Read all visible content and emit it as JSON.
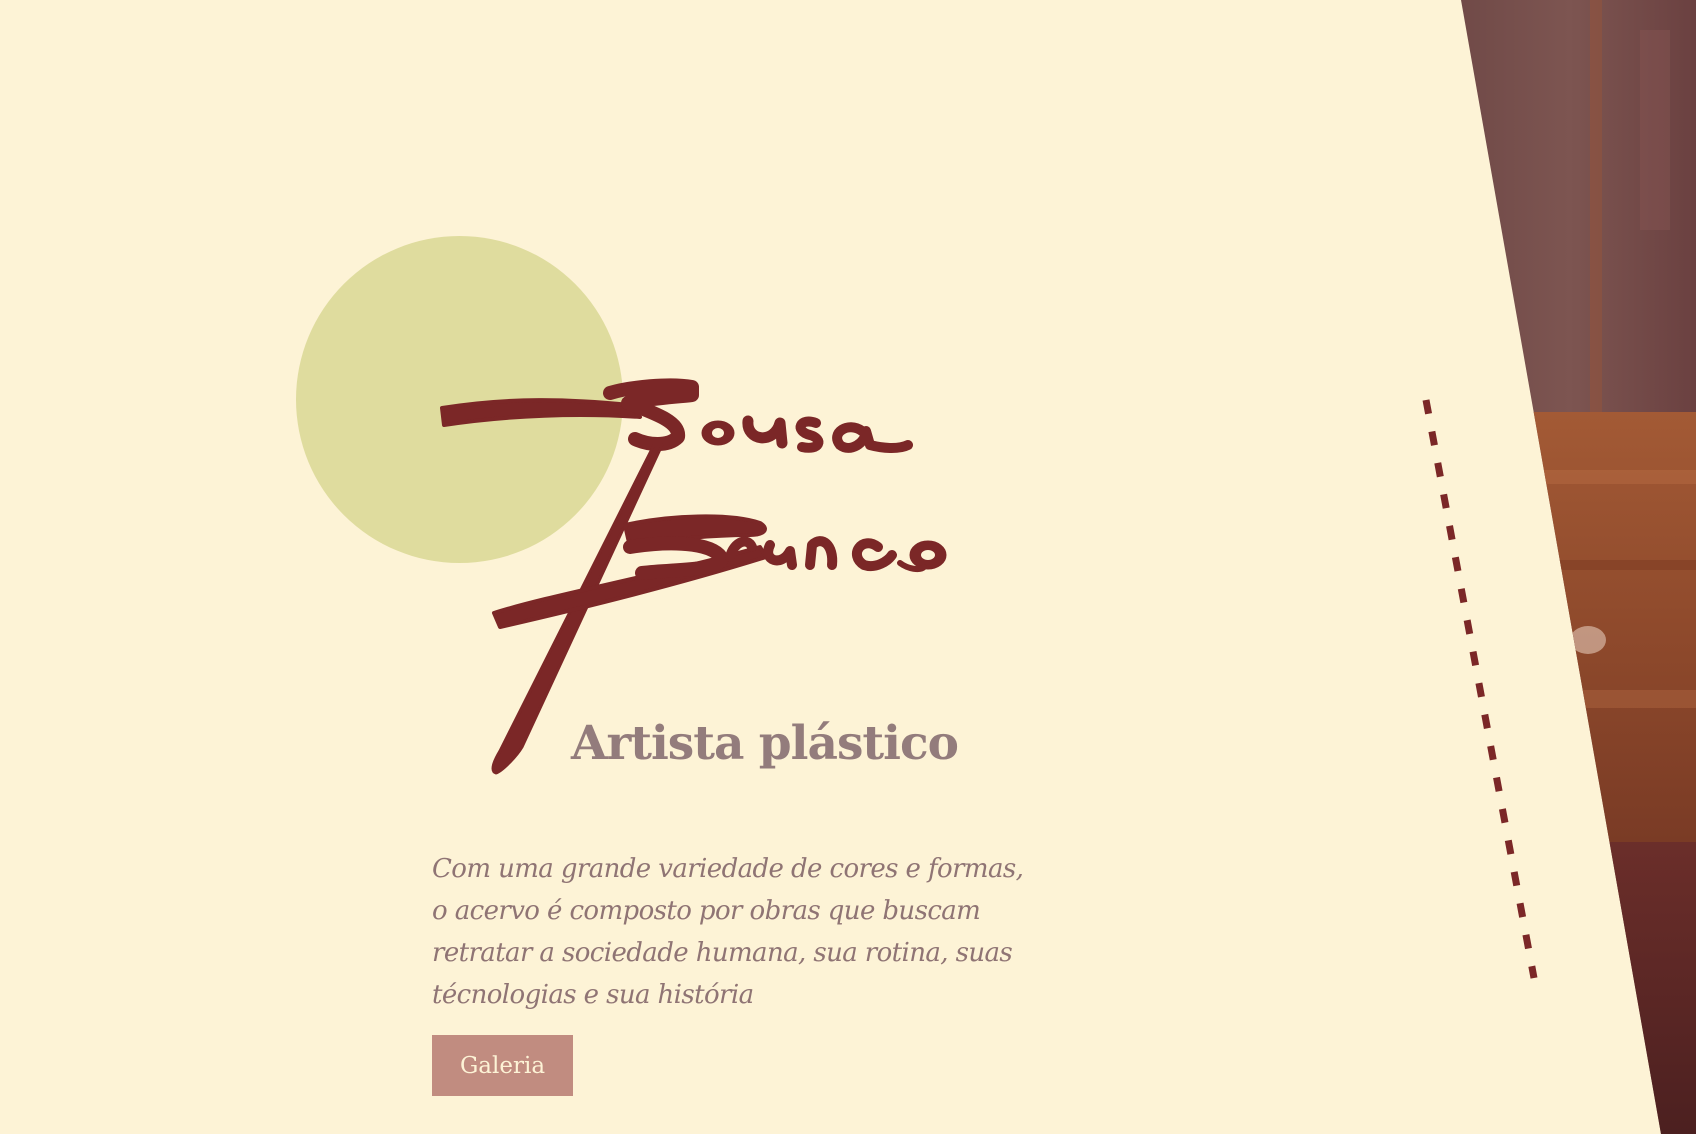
{
  "hero": {
    "brand": "Sousa Branco",
    "subtitle": "Artista plástico",
    "description": "Com uma grande variedade de cores e formas, o acervo é composto por obras que buscam retratar a sociedade humana, sua rotina, suas técnologias e sua história",
    "button_label": "Galeria"
  },
  "colors": {
    "background": "#fdf3d6",
    "accent_circle": "#dfdc9e",
    "signature": "#7b2727",
    "text_muted": "#937c7c",
    "button": "#c18c80",
    "button_text": "#fdf3d6"
  },
  "decor": {
    "photo": "painted-wood-texture",
    "divider": "dashed-line"
  }
}
